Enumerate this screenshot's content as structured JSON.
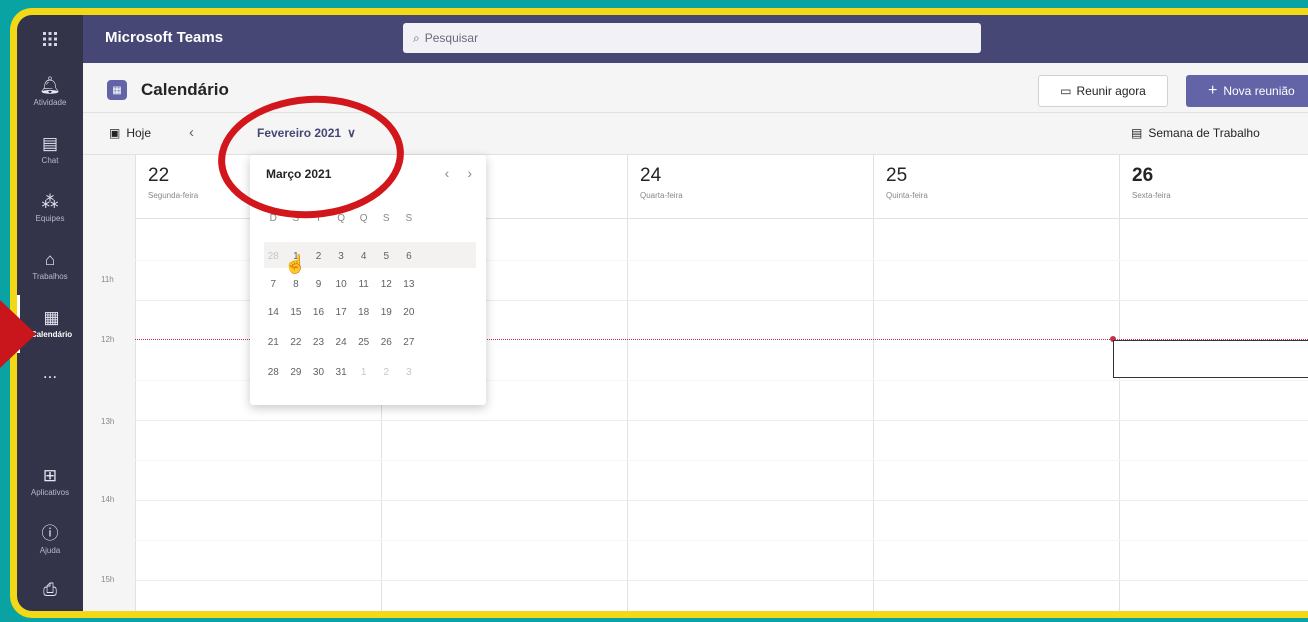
{
  "app": {
    "title": "Microsoft Teams",
    "search_placeholder": "Pesquisar"
  },
  "rail": {
    "items": [
      {
        "label": "Atividade",
        "icon": "bell-icon"
      },
      {
        "label": "Chat",
        "icon": "chat-icon"
      },
      {
        "label": "Equipes",
        "icon": "teams-icon"
      },
      {
        "label": "Trabalhos",
        "icon": "briefcase-icon"
      },
      {
        "label": "Calendário",
        "icon": "calendar-icon"
      }
    ],
    "more": "...",
    "bottom": [
      {
        "label": "Aplicativos",
        "icon": "apps-icon"
      },
      {
        "label": "Ajuda",
        "icon": "help-icon"
      }
    ]
  },
  "header": {
    "title": "Calendário",
    "meet_now": "Reunir agora",
    "new_meeting": "Nova reunião"
  },
  "toolbar": {
    "today": "Hoje",
    "month": "Fevereiro 2021",
    "view": "Semana de Trabalho"
  },
  "days": [
    {
      "num": "22",
      "name": "Segunda-feira"
    },
    {
      "num": "24",
      "name": "Quarta-feira"
    },
    {
      "num": "25",
      "name": "Quinta-feira"
    },
    {
      "num": "26",
      "name": "Sexta-feira"
    }
  ],
  "times": [
    "11h",
    "12h",
    "13h",
    "14h",
    "15h"
  ],
  "picker": {
    "title": "Março 2021",
    "weekdays": [
      "D",
      "S",
      "T",
      "Q",
      "Q",
      "S",
      "S"
    ],
    "weeks": [
      [
        "28",
        "1",
        "2",
        "3",
        "4",
        "5",
        "6"
      ],
      [
        "7",
        "8",
        "9",
        "10",
        "11",
        "12",
        "13"
      ],
      [
        "14",
        "15",
        "16",
        "17",
        "18",
        "19",
        "20"
      ],
      [
        "21",
        "22",
        "23",
        "24",
        "25",
        "26",
        "27"
      ],
      [
        "28",
        "29",
        "30",
        "31",
        "1",
        "2",
        "3"
      ]
    ]
  },
  "colors": {
    "accent": "#6264a7",
    "rail": "#33344a",
    "topbar": "#464775",
    "annotation": "#d1161c",
    "frame": "#f2d816"
  }
}
